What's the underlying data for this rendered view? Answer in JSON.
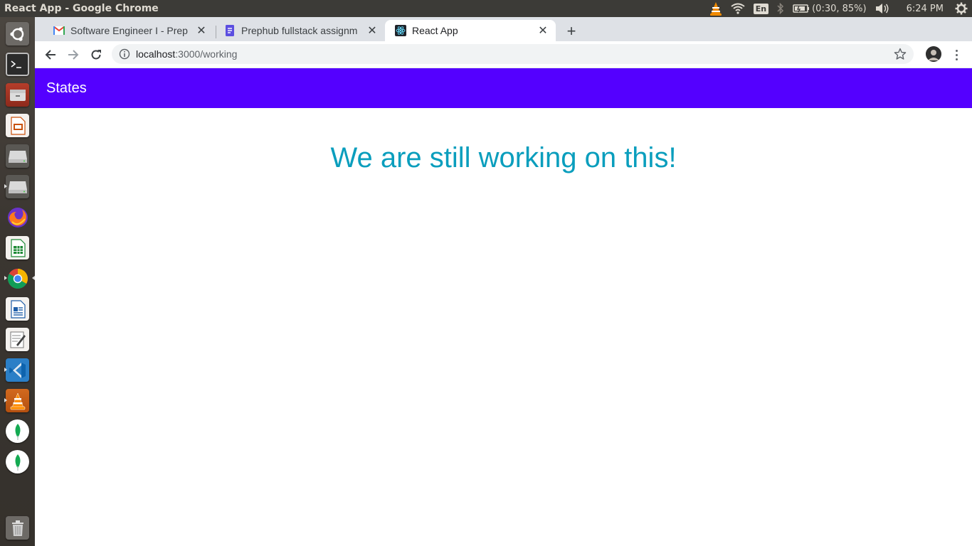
{
  "os_panel": {
    "window_title": "React App - Google Chrome",
    "keyboard_layout": "En",
    "battery_text": "(0:30, 85%)",
    "clock": "6:24 PM",
    "icons": [
      "vlc-tray-icon",
      "wifi-icon",
      "keyboard-layout-icon",
      "bluetooth-icon",
      "battery-icon",
      "volume-icon",
      "gear-icon"
    ]
  },
  "launcher": {
    "apps": [
      "Ubuntu Dash",
      "Terminal",
      "Files",
      "Impress",
      "Disk",
      "Disk",
      "Firefox",
      "Calc",
      "Chrome",
      "Writer",
      "Text Editor",
      "VS Code",
      "VLC",
      "MongoDB Compass",
      "MongoDB Compass",
      "Trash"
    ]
  },
  "browser": {
    "tabs": [
      {
        "title": "Software Engineer I - Prep",
        "favicon": "gmail-icon",
        "active": false
      },
      {
        "title": "Prephub fullstack assignm",
        "favicon": "docs-icon",
        "active": false
      },
      {
        "title": "React App",
        "favicon": "react-icon",
        "active": true
      }
    ],
    "new_tab_label": "+",
    "address": {
      "host": "localhost",
      "rest": ":3000/working"
    }
  },
  "app": {
    "header_title": "States",
    "message": "We are still working on this!"
  },
  "colors": {
    "appbar_bg": "#5400ff",
    "message_color": "#0a9ebd",
    "launcher_bg": "#3b3631"
  }
}
